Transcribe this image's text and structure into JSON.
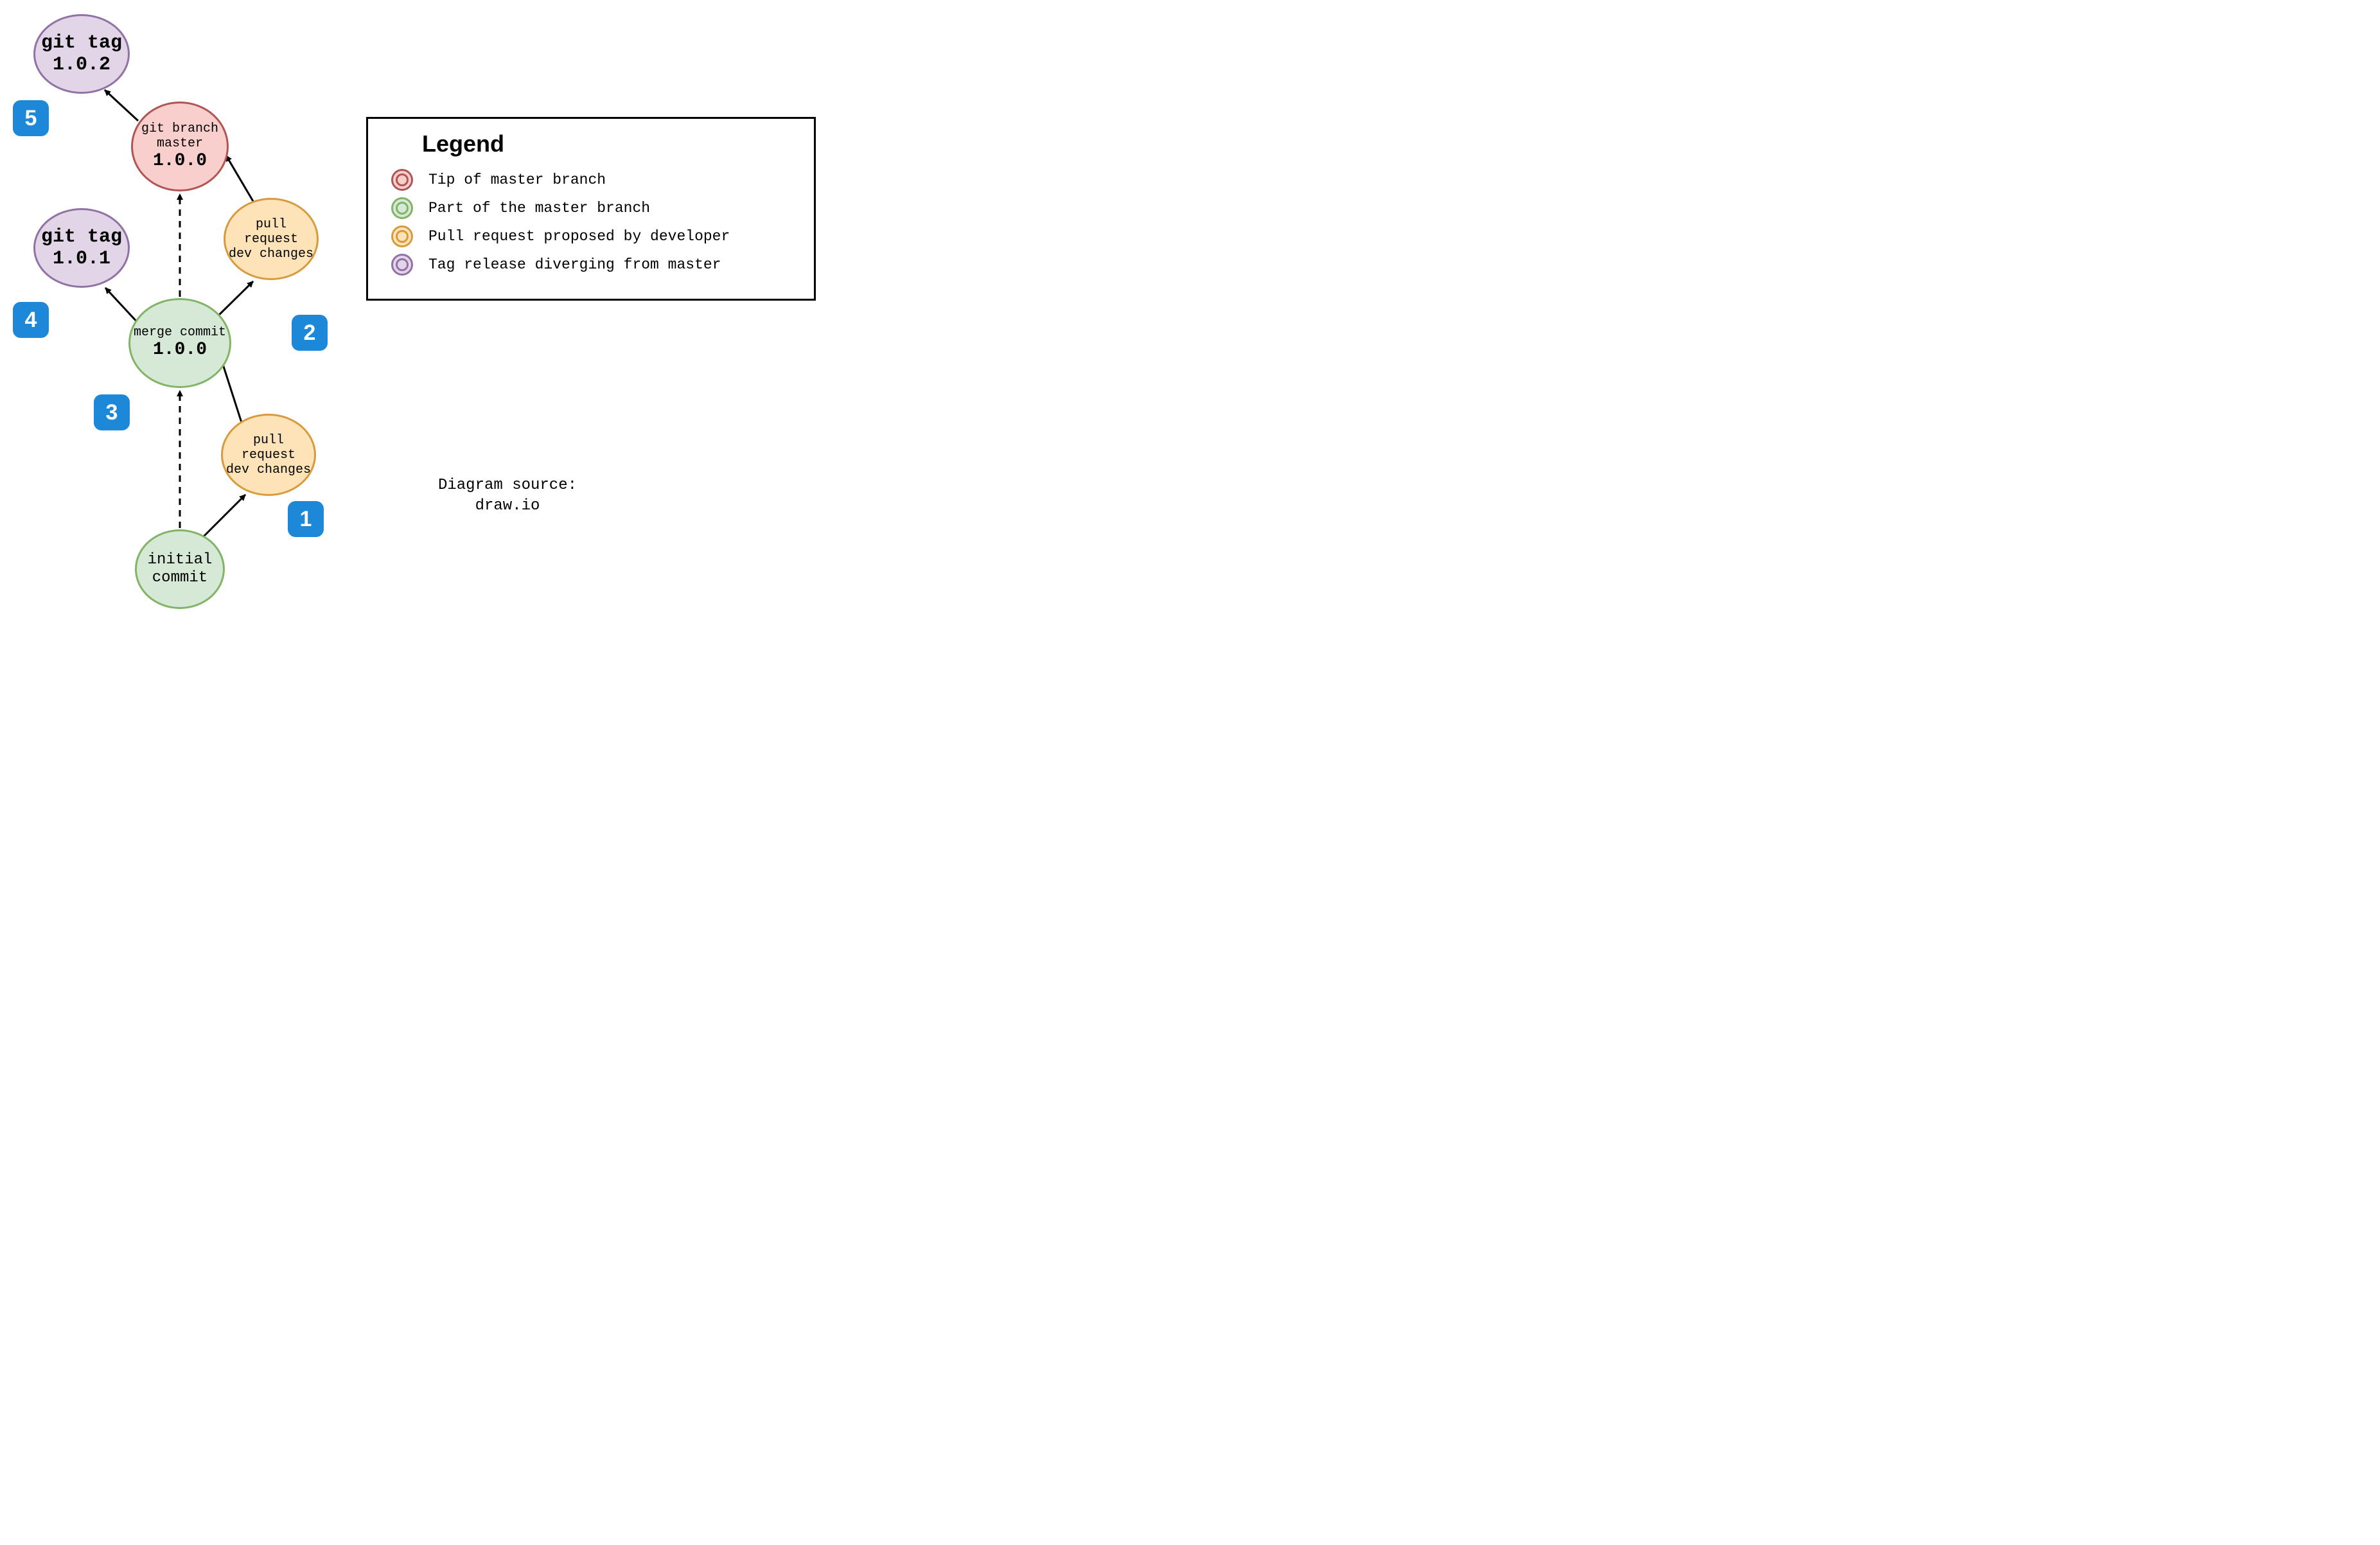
{
  "diagram": {
    "nodes": {
      "tag_102": {
        "line1": "git tag",
        "line2_bold": "1.0.2"
      },
      "master_100": {
        "line1": "git branch",
        "line2": "master",
        "line3_bold": "1.0.0"
      },
      "tag_101": {
        "line1": "git tag",
        "line2_bold": "1.0.1"
      },
      "pr_top": {
        "line1": "pull request",
        "line2": "dev changes"
      },
      "merge_100": {
        "line1": "merge commit",
        "line2_bold": "1.0.0"
      },
      "pr_bottom": {
        "line1": "pull request",
        "line2": "dev changes"
      },
      "initial": {
        "line1": "initial",
        "line2": "commit"
      }
    },
    "badges": {
      "b1": "1",
      "b2": "2",
      "b3": "3",
      "b4": "4",
      "b5": "5"
    },
    "legend": {
      "title": "Legend",
      "items": [
        {
          "color": "red",
          "text": "Tip of master branch"
        },
        {
          "color": "green",
          "text": "Part of the master branch"
        },
        {
          "color": "orange",
          "text": "Pull request proposed by developer"
        },
        {
          "color": "purple",
          "text": "Tag release diverging from master"
        }
      ]
    },
    "source_note": {
      "line1": "Diagram source:",
      "line2": "draw.io"
    }
  },
  "colors": {
    "red_fill": "#F8CFCC",
    "red_stroke": "#B15554",
    "green_fill": "#D6E8D6",
    "green_stroke": "#82B466",
    "orange_fill": "#FEE3B8",
    "orange_stroke": "#D79B3D",
    "purple_fill": "#E2D5E8",
    "purple_stroke": "#9271A5",
    "badge_bg": "#1E88D8"
  }
}
